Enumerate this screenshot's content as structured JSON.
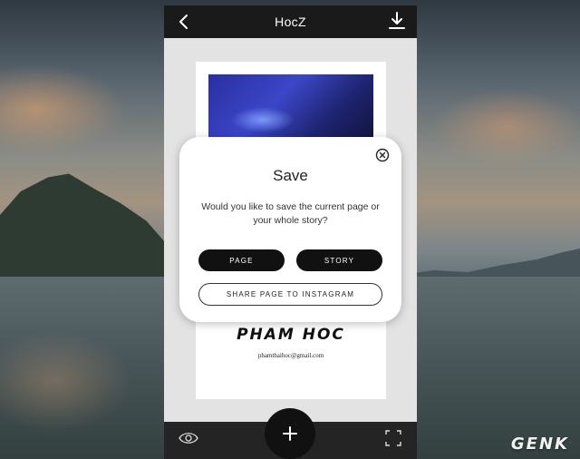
{
  "app": {
    "title": "HocZ"
  },
  "story": {
    "name": "PHAM HOC",
    "email": "phamthaihoc@gmail.com"
  },
  "modal": {
    "title": "Save",
    "message": "Would you like to save the current page or your whole story?",
    "page_label": "PAGE",
    "story_label": "STORY",
    "instagram_label": "SHARE PAGE TO INSTAGRAM"
  },
  "bottom": {
    "add_label": "+"
  },
  "watermark": "GENK",
  "icons": {
    "back": "chevron-left-icon",
    "download": "download-icon",
    "close": "close-circle-icon",
    "eye": "eye-icon",
    "crop": "crop-icon"
  },
  "colors": {
    "topbar": "#1a1a1a",
    "button": "#111111",
    "modal_bg": "#ffffff"
  }
}
